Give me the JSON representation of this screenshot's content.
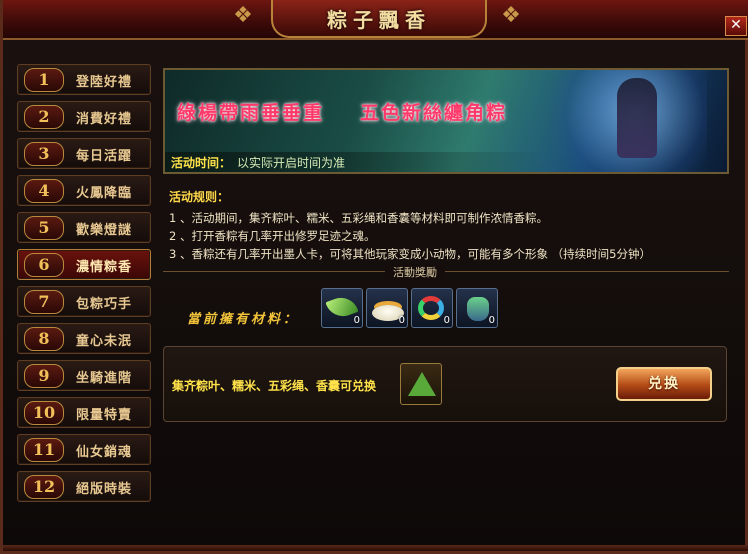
{
  "window": {
    "title": "粽子飄香",
    "close_label": "✕"
  },
  "sidebar": {
    "items": [
      {
        "num": "1",
        "label": "登陸好禮"
      },
      {
        "num": "2",
        "label": "消費好禮"
      },
      {
        "num": "3",
        "label": "每日活躍"
      },
      {
        "num": "4",
        "label": "火鳳降臨"
      },
      {
        "num": "5",
        "label": "歡樂燈謎"
      },
      {
        "num": "6",
        "label": "濃情粽香"
      },
      {
        "num": "7",
        "label": "包粽巧手"
      },
      {
        "num": "8",
        "label": "童心未泯"
      },
      {
        "num": "9",
        "label": "坐騎進階"
      },
      {
        "num": "10",
        "label": "限量特賣"
      },
      {
        "num": "11",
        "label": "仙女銷魂"
      },
      {
        "num": "12",
        "label": "絕版時裝"
      }
    ],
    "active_index": 5
  },
  "banner": {
    "title_part1": "綠楊帶雨垂垂重",
    "title_part2": "五色新絲纏角粽",
    "time_label": "活动时间：",
    "time_value": "以实际开启时间为准"
  },
  "rules": {
    "title": "活动规则：",
    "lines": [
      "1 、活动期间，集齐粽叶、糯米、五彩绳和香囊等材料即可制作浓情香粽。",
      "2 、打开香粽有几率开出修罗足迹之魂。",
      "3 、香粽还有几率开出墨人卡，可将其他玩家变成小动物，可能有多个形象 （持续时间5分钟）"
    ]
  },
  "rewards": {
    "divider_label": "活動獎勵",
    "owned_label": "當前擁有材料：",
    "items": [
      {
        "icon": "leaf-icon",
        "count": "0"
      },
      {
        "icon": "rice-icon",
        "count": "0"
      },
      {
        "icon": "rope-icon",
        "count": "0"
      },
      {
        "icon": "pouch-icon",
        "count": "0"
      }
    ]
  },
  "exchange": {
    "text": "集齐粽叶、糯米、五彩绳、香囊可兑换",
    "reward_icon": "zongzi-icon",
    "button_label": "兑换"
  },
  "colors": {
    "accent_gold": "#f0c33a",
    "title_red": "#ff3a6a",
    "frame_dark": "#0a0605"
  }
}
